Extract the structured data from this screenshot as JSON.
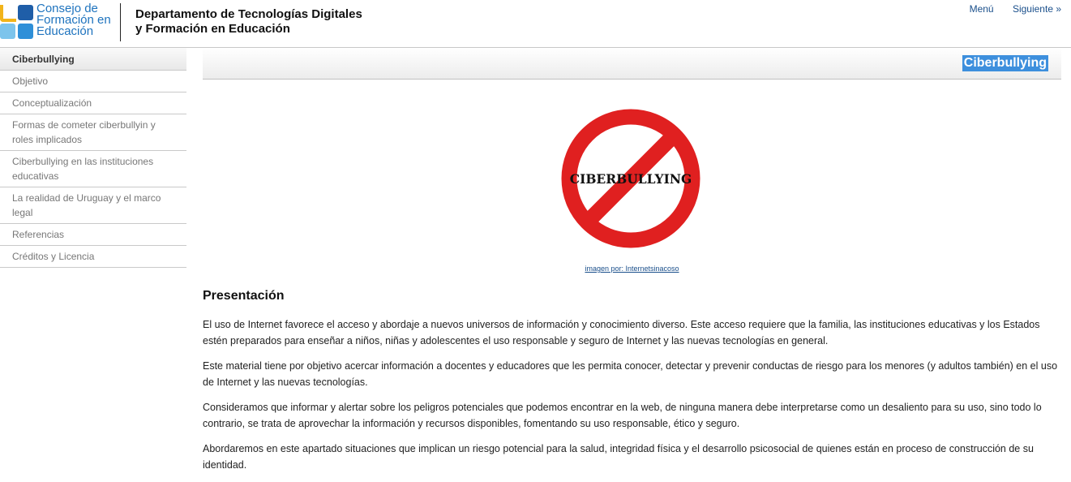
{
  "header": {
    "logo": {
      "line1": "Consejo de",
      "line2": "Formación en",
      "line3": "Educación",
      "colors": {
        "yellow": "#f2b41a",
        "dark_blue": "#1f5ea8",
        "light_blue": "#7cc4ec",
        "mid_blue": "#2e8fd8"
      }
    },
    "department": {
      "line1": "Departamento de Tecnologías Digitales",
      "line2": "y Formación en Educación"
    },
    "nav": {
      "menu_label": "Menú",
      "next_label": "Siguiente »"
    }
  },
  "sidebar": {
    "items": [
      {
        "label": "Ciberbullying",
        "active": true
      },
      {
        "label": "Objetivo"
      },
      {
        "label": "Conceptualización"
      },
      {
        "label": "Formas de cometer ciberbullyin y roles implicados"
      },
      {
        "label": "Ciberbullying en las instituciones educativas"
      },
      {
        "label": "La realidad de Uruguay y el marco legal"
      },
      {
        "label": "Referencias"
      },
      {
        "label": "Créditos y Licencia"
      }
    ]
  },
  "main": {
    "title": "Ciberbullying",
    "image": {
      "text": "CIBERBULLYING",
      "icon": "no-entry-prohibition-icon",
      "ring_color": "#e02020"
    },
    "caption": "imagen por: Internetsinacoso",
    "section_heading": "Presentación",
    "paragraphs": [
      "El uso de Internet favorece el acceso y abordaje a nuevos universos de información y conocimiento diverso. Este acceso requiere que la familia, las instituciones educativas y los Estados estén preparados para enseñar a niños, niñas y adolescentes el uso responsable y seguro de Internet y las nuevas tecnologías en general.",
      "Este material tiene por objetivo acercar información a docentes y educadores que les permita conocer, detectar y prevenir conductas de riesgo para los menores (y adultos también) en el uso de Internet y las nuevas tecnologías.",
      "Consideramos que informar y alertar sobre los peligros potenciales que podemos encontrar en la web, de ninguna manera debe interpretarse como un desaliento para su uso, sino todo lo contrario, se trata de aprovechar la información y recursos disponibles, fomentando su uso responsable, ético y seguro.",
      " Abordaremos en este apartado situaciones que implican un riesgo potencial para la salud, integridad física y el desarrollo psicosocial de quienes están en proceso de construcción de su identidad."
    ]
  }
}
